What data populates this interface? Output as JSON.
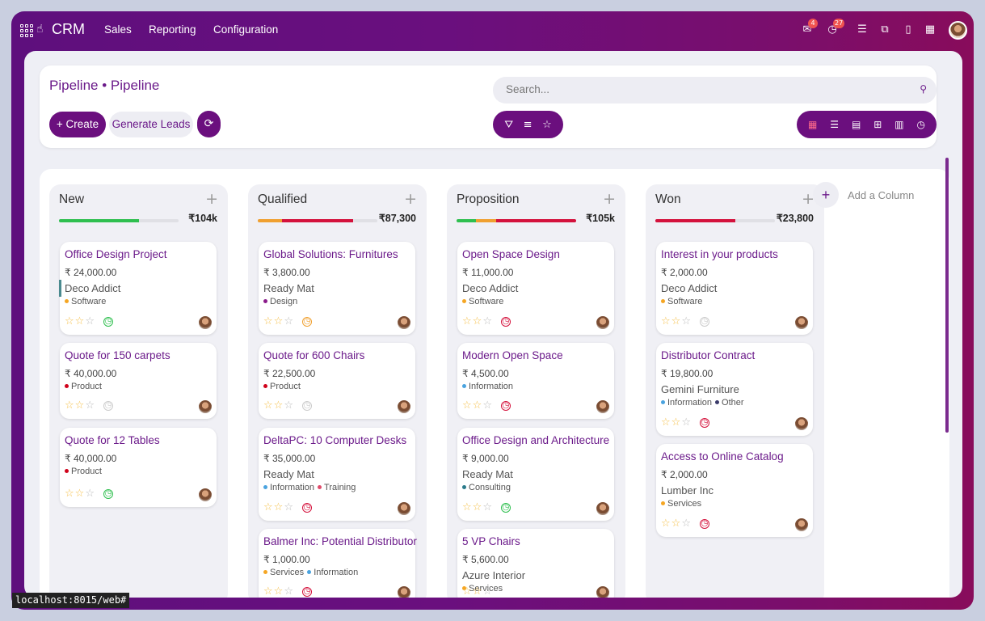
{
  "topbar": {
    "brand": "CRM",
    "menu": [
      "Sales",
      "Reporting",
      "Configuration"
    ],
    "badges": {
      "messages": "4",
      "activities": "27"
    }
  },
  "control_panel": {
    "breadcrumb": "Pipeline • Pipeline",
    "create_label": "+ Create",
    "generate_label": "Generate Leads",
    "search_placeholder": "Search..."
  },
  "columns": [
    {
      "title": "New",
      "total": "₹104k",
      "progress": [
        {
          "pct": 67,
          "color": "#2fbf4f"
        }
      ],
      "cards": [
        {
          "title": "Office Design Project",
          "amount": "₹ 24,000.00",
          "customer": "Deco Addict",
          "tags": [
            {
              "label": "Software",
              "color": "#f5a623"
            }
          ],
          "stars": 0,
          "activity": "green",
          "stripe": true
        },
        {
          "title": "Quote for 150 carpets",
          "amount": "₹ 40,000.00",
          "customer": "",
          "tags": [
            {
              "label": "Product",
              "color": "#d0021b"
            }
          ],
          "stars": 0,
          "activity": "grey"
        },
        {
          "title": "Quote for 12 Tables",
          "amount": "₹ 40,000.00",
          "customer": "",
          "tags": [
            {
              "label": "Product",
              "color": "#d0021b"
            }
          ],
          "stars": 0,
          "activity": "green"
        }
      ]
    },
    {
      "title": "Qualified",
      "total": "₹87,300",
      "progress": [
        {
          "pct": 20,
          "color": "#f0a030"
        },
        {
          "pct": 60,
          "color": "#d4123c"
        }
      ],
      "cards": [
        {
          "title": "Global Solutions: Furnitures",
          "amount": "₹ 3,800.00",
          "customer": "Ready Mat",
          "tags": [
            {
              "label": "Design",
              "color": "#8a1a8a"
            }
          ],
          "stars": 0,
          "activity": "orange"
        },
        {
          "title": "Quote for 600 Chairs",
          "amount": "₹ 22,500.00",
          "customer": "",
          "tags": [
            {
              "label": "Product",
              "color": "#d0021b"
            }
          ],
          "stars": 0,
          "activity": "grey"
        },
        {
          "title": "DeltaPC: 10 Computer Desks",
          "amount": "₹ 35,000.00",
          "customer": "Ready Mat",
          "tags": [
            {
              "label": "Information",
              "color": "#4aa3df"
            },
            {
              "label": "Training",
              "color": "#e04a6a"
            }
          ],
          "stars": 0,
          "activity": "red"
        },
        {
          "title": "Balmer Inc: Potential Distributor",
          "amount": "₹ 1,000.00",
          "customer": "",
          "tags": [
            {
              "label": "Services",
              "color": "#f5a623"
            },
            {
              "label": "Information",
              "color": "#4aa3df"
            }
          ],
          "stars": 0,
          "activity": "red"
        }
      ]
    },
    {
      "title": "Proposition",
      "total": "₹105k",
      "progress": [
        {
          "pct": 16,
          "color": "#2fbf4f"
        },
        {
          "pct": 17,
          "color": "#f0a030"
        },
        {
          "pct": 67,
          "color": "#d4123c"
        }
      ],
      "cards": [
        {
          "title": "Open Space Design",
          "amount": "₹ 11,000.00",
          "customer": "Deco Addict",
          "tags": [
            {
              "label": "Software",
              "color": "#f5a623"
            }
          ],
          "stars": 0,
          "activity": "red"
        },
        {
          "title": "Modern Open Space",
          "amount": "₹ 4,500.00",
          "customer": "",
          "tags": [
            {
              "label": "Information",
              "color": "#4aa3df"
            }
          ],
          "stars": 0,
          "activity": "red"
        },
        {
          "title": "Office Design and Architecture",
          "amount": "₹ 9,000.00",
          "customer": "Ready Mat",
          "tags": [
            {
              "label": "Consulting",
              "color": "#2a7a8a"
            }
          ],
          "stars": 0,
          "activity": "green"
        },
        {
          "title": "5 VP Chairs",
          "amount": "₹ 5,600.00",
          "customer": "Azure Interior",
          "tags": [
            {
              "label": "Services",
              "color": "#f5a623"
            }
          ],
          "stars": 0,
          "activity": ""
        }
      ]
    },
    {
      "title": "Won",
      "total": "₹23,800",
      "progress": [
        {
          "pct": 67,
          "color": "#d4123c"
        }
      ],
      "cards": [
        {
          "title": "Interest in your products",
          "amount": "₹ 2,000.00",
          "customer": "Deco Addict",
          "tags": [
            {
              "label": "Software",
              "color": "#f5a623"
            }
          ],
          "stars": 0,
          "activity": "grey"
        },
        {
          "title": "Distributor Contract",
          "amount": "₹ 19,800.00",
          "customer": "Gemini Furniture",
          "tags": [
            {
              "label": "Information",
              "color": "#4aa3df"
            },
            {
              "label": "Other",
              "color": "#3a3a6a"
            }
          ],
          "stars": 0,
          "activity": "red"
        },
        {
          "title": "Access to Online Catalog",
          "amount": "₹ 2,000.00",
          "customer": "Lumber Inc",
          "tags": [
            {
              "label": "Services",
              "color": "#f5a623"
            }
          ],
          "stars": 0,
          "activity": "red"
        }
      ]
    }
  ],
  "add_column_label": "Add a Column",
  "status_url": "localhost:8015/web#",
  "colors": {
    "brand": "#6b0f7e",
    "accent": "#6b1a8a"
  }
}
